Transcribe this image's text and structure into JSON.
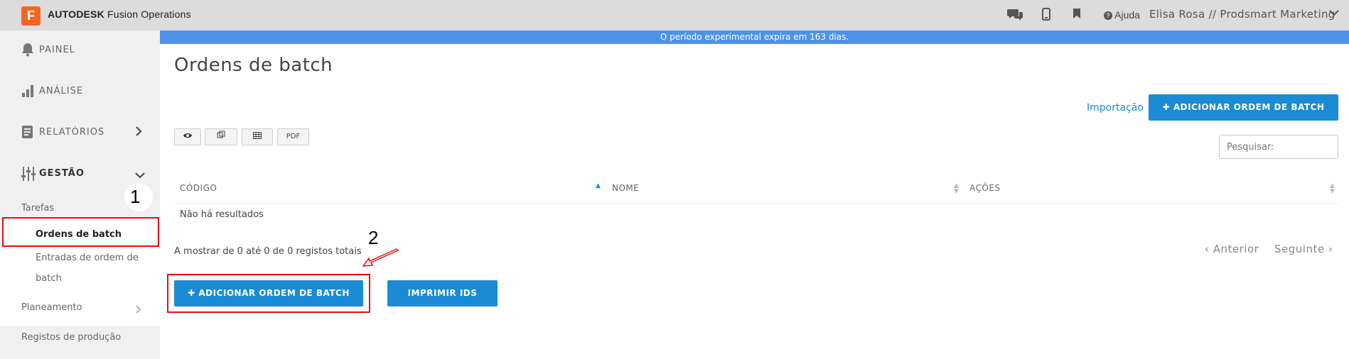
{
  "header": {
    "logo_letter": "F",
    "brand_bold": "AUTODESK",
    "brand_rest": " Fusion Operations",
    "help_label": "Ajuda",
    "user_label": "Elisa Rosa // Prodsmart Marketing"
  },
  "banner": "O período experimental expira em 163 dias.",
  "sidebar": {
    "painel": "PAINEL",
    "analise": "ANÁLISE",
    "relatorios": "RELATÓRIOS",
    "gestao": "GESTÃO",
    "tarefas": "Tarefas",
    "ordens": "Ordens de batch",
    "entradas_1": "Entradas de ordem de",
    "entradas_2": "batch",
    "planeamento": "Planeamento",
    "registos": "Registos de produção"
  },
  "main": {
    "title": "Ordens de batch",
    "import_link": "Importação",
    "add_button_top": "✚ ADICIONAR ORDEM DE BATCH",
    "pdf_label": "PDF",
    "search_placeholder": "Pesquisar:",
    "columns": [
      "CÓDIGO",
      "NOME",
      "AÇÕES"
    ],
    "empty_text": "Não há resultados",
    "info_text": "A mostrar de 0 até 0 de 0 registos totais",
    "prev_label": "‹ Anterior",
    "next_label": "Seguinte ›",
    "add_button_bottom": "✚ ADICIONAR ORDEM DE BATCH",
    "print_button": "IMPRIMIR IDS"
  },
  "annotations": {
    "step1": "1",
    "step2": "2"
  },
  "colors": {
    "accent": "#1a8bd4",
    "banner": "#4d94e8",
    "logo": "#f26522",
    "annotation": "#e01010"
  }
}
